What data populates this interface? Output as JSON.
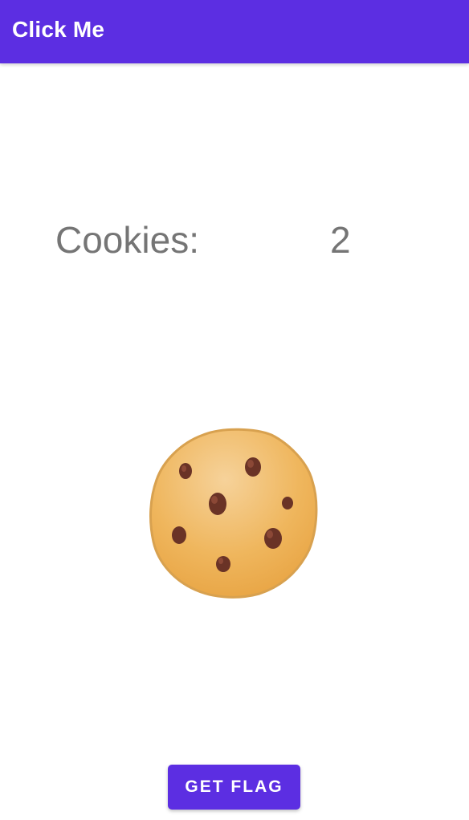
{
  "app_bar": {
    "title": "Click Me",
    "color": "#5c2ee2"
  },
  "counter": {
    "label": "Cookies:",
    "value": "2"
  },
  "cookie": {
    "icon": "cookie-icon"
  },
  "actions": {
    "get_flag_label": "GET FLAG"
  }
}
